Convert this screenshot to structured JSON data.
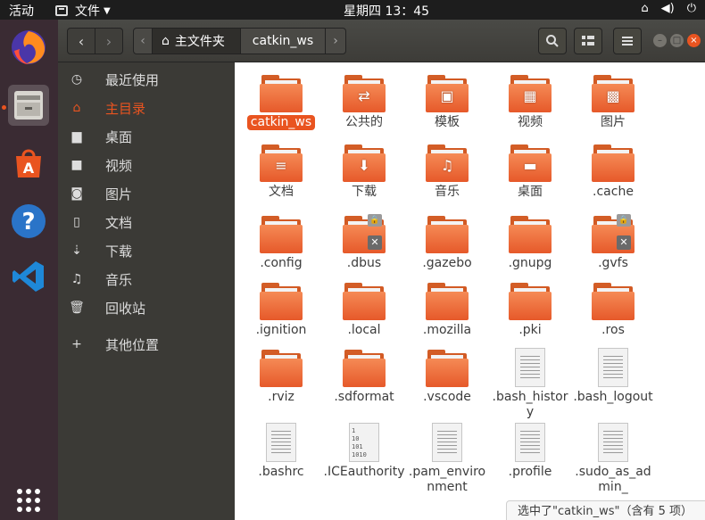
{
  "topbar": {
    "activities": "活动",
    "app_menu": "文件",
    "clock": "星期四 13：45"
  },
  "dock": {
    "items": [
      "firefox-icon",
      "files-icon",
      "software-center-icon",
      "help-icon",
      "vscode-icon",
      "show-apps-icon"
    ]
  },
  "header": {
    "crumb_home": "主文件夹",
    "crumb_current": "catkin_ws"
  },
  "sidebar": {
    "items": [
      {
        "label": "最近使用",
        "icon": "clock-icon"
      },
      {
        "label": "主目录",
        "icon": "home-icon"
      },
      {
        "label": "桌面",
        "icon": "desktop-icon"
      },
      {
        "label": "视频",
        "icon": "video-icon"
      },
      {
        "label": "图片",
        "icon": "camera-icon"
      },
      {
        "label": "文档",
        "icon": "document-icon"
      },
      {
        "label": "下载",
        "icon": "download-icon"
      },
      {
        "label": "音乐",
        "icon": "music-icon"
      },
      {
        "label": "回收站",
        "icon": "trash-icon"
      },
      {
        "label": "其他位置",
        "icon": "plus-icon"
      }
    ]
  },
  "files": [
    {
      "name": "catkin_ws",
      "type": "folder"
    },
    {
      "name": "公共的",
      "type": "folder"
    },
    {
      "name": "模板",
      "type": "folder"
    },
    {
      "name": "视频",
      "type": "folder"
    },
    {
      "name": "图片",
      "type": "folder"
    },
    {
      "name": "文档",
      "type": "folder"
    },
    {
      "name": "下载",
      "type": "folder"
    },
    {
      "name": "音乐",
      "type": "folder"
    },
    {
      "name": "桌面",
      "type": "folder"
    },
    {
      "name": ".cache",
      "type": "folder"
    },
    {
      "name": ".config",
      "type": "folder"
    },
    {
      "name": ".dbus",
      "type": "folder"
    },
    {
      "name": ".gazebo",
      "type": "folder"
    },
    {
      "name": ".gnupg",
      "type": "folder"
    },
    {
      "name": ".gvfs",
      "type": "folder"
    },
    {
      "name": ".ignition",
      "type": "folder"
    },
    {
      "name": ".local",
      "type": "folder"
    },
    {
      "name": ".mozilla",
      "type": "folder"
    },
    {
      "name": ".pki",
      "type": "folder"
    },
    {
      "name": ".ros",
      "type": "folder"
    },
    {
      "name": ".rviz",
      "type": "folder"
    },
    {
      "name": ".sdformat",
      "type": "folder"
    },
    {
      "name": ".vscode",
      "type": "folder"
    },
    {
      "name": ".bash_history",
      "type": "text"
    },
    {
      "name": ".bash_logout",
      "type": "text"
    },
    {
      "name": ".bashrc",
      "type": "text"
    },
    {
      "name": ".ICEauthority",
      "type": "binary",
      "bin_text": "1\n10\n101\n1010"
    },
    {
      "name": ".pam_environment",
      "type": "text"
    },
    {
      "name": ".profile",
      "type": "text"
    },
    {
      "name": ".sudo_as_admin_",
      "type": "text"
    }
  ],
  "status": "选中了\"catkin_ws\"（含有 5 项）"
}
